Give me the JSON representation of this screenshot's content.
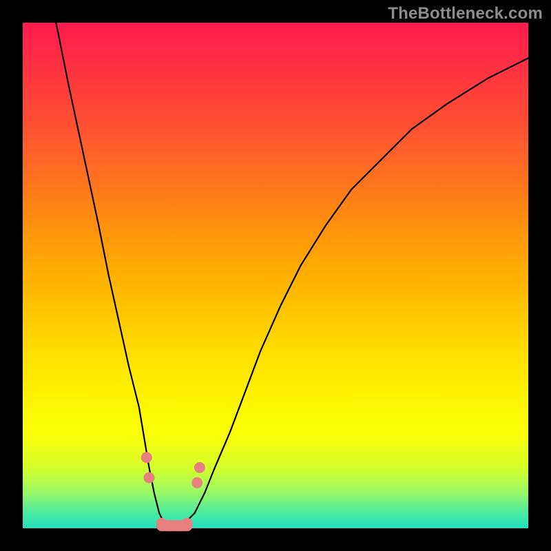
{
  "watermark": "TheBottleneck.com",
  "colors": {
    "frame": "#000000",
    "curve": "#000000",
    "marker": "#e78180",
    "gradient_top": "#ff1b4f",
    "gradient_bottom": "#23e0bd"
  },
  "chart_data": {
    "type": "line",
    "title": "",
    "xlabel": "",
    "ylabel": "",
    "xlim": [
      0,
      100
    ],
    "ylim": [
      0,
      100
    ],
    "x": [
      0,
      3,
      6,
      9,
      12,
      15,
      17,
      19,
      21,
      23,
      24,
      25,
      26,
      27,
      28,
      29,
      30,
      32,
      34,
      36,
      38,
      41,
      44,
      47,
      51,
      55,
      60,
      65,
      71,
      77,
      84,
      92,
      100
    ],
    "values": [
      140,
      120,
      103,
      88,
      74,
      60,
      50,
      41,
      32,
      24,
      18,
      12,
      7,
      3,
      1,
      0,
      0,
      1,
      3,
      7,
      12,
      19,
      27,
      35,
      44,
      52,
      60,
      67,
      73,
      79,
      84,
      89,
      93
    ],
    "annotations": {
      "flat_bottom_x_range": [
        27.5,
        32.5
      ],
      "flat_bottom_y": 0.5,
      "marker_points_xy": [
        [
          24.5,
          14
        ],
        [
          25,
          10
        ],
        [
          27.5,
          1
        ],
        [
          29,
          0.5
        ],
        [
          31,
          0.5
        ],
        [
          32.5,
          1
        ],
        [
          34.5,
          9
        ],
        [
          35,
          12
        ]
      ]
    }
  }
}
